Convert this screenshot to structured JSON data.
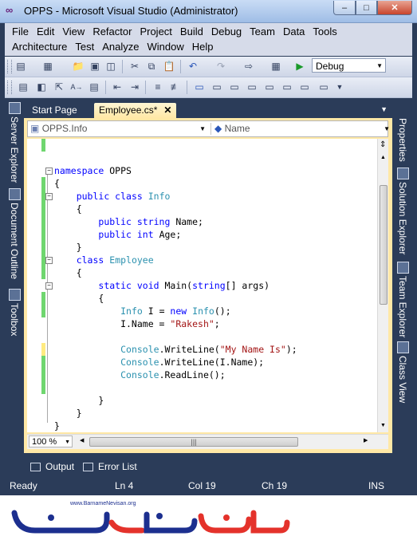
{
  "window": {
    "title": "OPPS - Microsoft Visual Studio (Administrator)",
    "app_icon": "visual-studio-icon",
    "controls": {
      "minimize": "–",
      "maximize": "□",
      "close": "✕"
    }
  },
  "menu": {
    "row1": [
      "File",
      "Edit",
      "View",
      "Refactor",
      "Project",
      "Build",
      "Debug",
      "Team",
      "Data",
      "Tools"
    ],
    "row2": [
      "Architecture",
      "Test",
      "Analyze",
      "Window",
      "Help"
    ]
  },
  "toolbar": {
    "configuration": "Debug"
  },
  "left_sidebar": [
    "Server Explorer",
    "Document Outline",
    "Toolbox"
  ],
  "right_sidebar": [
    "Properties",
    "Solution Explorer",
    "Team Explorer",
    "Class View"
  ],
  "tabs": [
    {
      "label": "Start Page",
      "active": false
    },
    {
      "label": "Employee.cs*",
      "active": true,
      "close": "✕"
    }
  ],
  "nav": {
    "type_combo": "OPPS.Info",
    "member_combo": "Name"
  },
  "code_lines": [
    "",
    "",
    "namespace OPPS",
    "{",
    "    public class Info",
    "    {",
    "        public string Name;",
    "        public int Age;",
    "    }",
    "    class Employee",
    "    {",
    "        static void Main(string[] args)",
    "        {",
    "            Info I = new Info();",
    "            I.Name = \"Rakesh\";",
    "",
    "            Console.WriteLine(\"My Name Is\");",
    "            Console.WriteLine(I.Name);",
    "            Console.ReadLine();",
    "",
    "        }",
    "    }",
    "}"
  ],
  "zoom": "100 %",
  "bottom_tabs": [
    "Output",
    "Error List"
  ],
  "status": {
    "state": "Ready",
    "line": "Ln 4",
    "col": "Col 19",
    "ch": "Ch 19",
    "mode": "INS"
  },
  "watermark": {
    "text": "www.BarnameNevisan.org",
    "logo_text": "برنامه نویسان"
  },
  "colors": {
    "frame": "#2b3c59",
    "tab_active": "#ffe8a6",
    "keyword": "#0000ff",
    "type": "#2b91af",
    "string": "#a31515",
    "change_saved": "#6fd66f",
    "change_unsaved": "#ffeb80",
    "logo_red": "#e4322b",
    "logo_blue": "#1c2f8f"
  }
}
